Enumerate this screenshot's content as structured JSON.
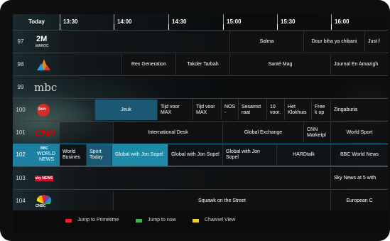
{
  "header": {
    "day": "Today",
    "times": [
      "13:30",
      "14:00",
      "14:30",
      "15:00",
      "15:30",
      "16:00"
    ]
  },
  "channels": [
    {
      "number": "97",
      "logo_name": "2m-maroc-logo",
      "logo_text": "2M",
      "logo_sub": "MAROC",
      "programs": [
        {
          "title": "Salma"
        },
        {
          "title": "Dour biha ya chibani"
        },
        {
          "title": "Just f"
        }
      ]
    },
    {
      "number": "98",
      "logo_name": "al-aoula-logo",
      "logo_text": "",
      "programs": [
        {
          "title": "Rex Generation"
        },
        {
          "title": "Takder Tarbah"
        },
        {
          "title": "Santé Mag"
        },
        {
          "title": "Journal En Amazigh"
        }
      ]
    },
    {
      "number": "99",
      "logo_name": "mbc-logo",
      "logo_text": "mbc",
      "programs": []
    },
    {
      "number": "100",
      "logo_name": "bvn-logo",
      "logo_text": "bvn",
      "programs": [
        {
          "title": "Jeuk"
        },
        {
          "title": "Tijd voor MAX"
        },
        {
          "title": "Tijd voor MAX"
        },
        {
          "title": "NOS -"
        },
        {
          "title": "Sesamst raat"
        },
        {
          "title": "10 voor."
        },
        {
          "title": "Het Klokhuis"
        },
        {
          "title": "Free k op"
        },
        {
          "title": "Zingaburia"
        }
      ]
    },
    {
      "number": "101",
      "logo_name": "cnn-logo",
      "logo_text": "CNN",
      "programs": [
        {
          "title": "International Desk"
        },
        {
          "title": "Global Exchange"
        },
        {
          "title": "CNN Marketpl"
        },
        {
          "title": "World Sport"
        }
      ]
    },
    {
      "number": "102",
      "logo_name": "bbc-world-news-logo",
      "logo_text": "BBC",
      "logo_sub1": "WORLD",
      "logo_sub2": "NEWS",
      "programs": [
        {
          "title": "World Busines"
        },
        {
          "title": "Sport Today"
        },
        {
          "title": "Global with Jon Sopel"
        },
        {
          "title": "Global with Jon Sopel"
        },
        {
          "title": "Global with Jon Sopel"
        },
        {
          "title": "HARDtalk"
        },
        {
          "title": "BBC World News"
        }
      ]
    },
    {
      "number": "103",
      "logo_name": "sky-news-logo",
      "logo_text": "sky NEWS",
      "programs": [
        {
          "title": "Sky News at 5 with"
        }
      ]
    },
    {
      "number": "104",
      "logo_name": "cnbc-logo",
      "logo_text": "CNBC",
      "programs": [
        {
          "title": "Squawk on the Street"
        },
        {
          "title": "European C"
        }
      ]
    }
  ],
  "footer": {
    "legend": [
      {
        "label": "Jump to Primetime",
        "color": "#e0262b"
      },
      {
        "label": "Jump to now",
        "color": "#3cb54a"
      },
      {
        "label": "Channel View",
        "color": "#f2d21b"
      }
    ]
  },
  "colors": {
    "selected": "#1e8aa8",
    "highlight_row": "#1f7fa0",
    "cnn_red": "#cc0000"
  }
}
